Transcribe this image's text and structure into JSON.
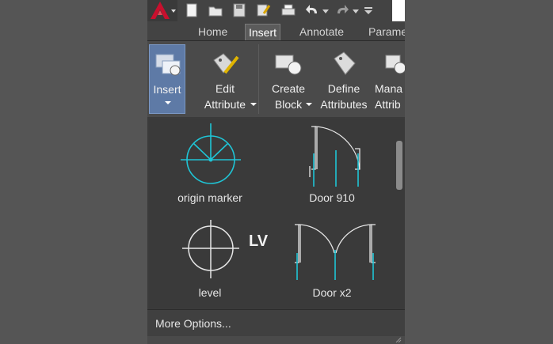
{
  "colors": {
    "accent": "#5e7aa6",
    "cad_cyan": "#1fc5d6",
    "logo_red": "#c8102e"
  },
  "quick_access": {
    "icons": [
      "app-logo-icon",
      "new-file-icon",
      "open-file-icon",
      "save-icon",
      "save-as-icon",
      "print-icon",
      "undo-icon",
      "redo-icon",
      "customize-icon"
    ]
  },
  "tabs": [
    {
      "label": "Home",
      "active": false
    },
    {
      "label": "Insert",
      "active": true
    },
    {
      "label": "Annotate",
      "active": false
    },
    {
      "label": "Parame",
      "active": false
    }
  ],
  "ribbon": {
    "insert": {
      "line1": "Insert",
      "icon": "insert-block-icon"
    },
    "edit_attribute": {
      "line1": "Edit",
      "line2": "Attribute",
      "icon": "edit-attribute-icon"
    },
    "create_block": {
      "line1": "Create",
      "line2": "Block",
      "icon": "create-block-icon"
    },
    "define_attributes": {
      "line1": "Define",
      "line2": "Attributes",
      "icon": "define-attributes-icon"
    },
    "manage_attributes": {
      "line1": "Mana",
      "line2": "Attrib",
      "icon": "manage-attributes-icon"
    }
  },
  "gallery": {
    "items": [
      {
        "label": "origin marker"
      },
      {
        "label": "Door 910"
      },
      {
        "label": "level",
        "symbol_text": "LV"
      },
      {
        "label": "Door x2"
      }
    ]
  },
  "footer": {
    "more_options": "More Options..."
  }
}
